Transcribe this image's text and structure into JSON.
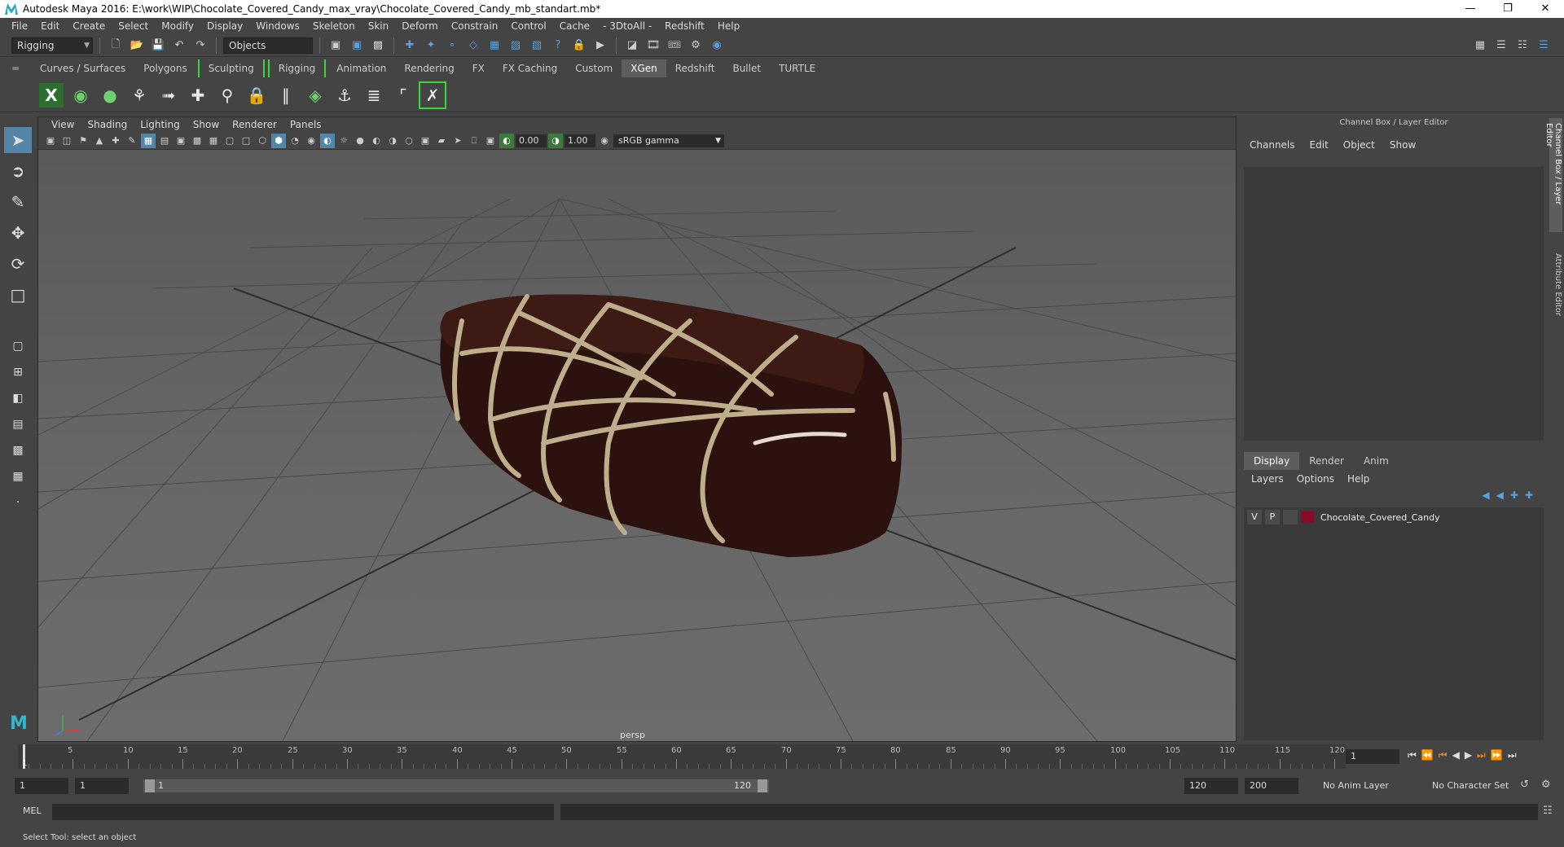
{
  "window": {
    "title": "Autodesk Maya 2016: E:\\work\\WIP\\Chocolate_Covered_Candy_max_vray\\Chocolate_Covered_Candy_mb_standart.mb*"
  },
  "menubar": [
    "File",
    "Edit",
    "Create",
    "Select",
    "Modify",
    "Display",
    "Windows",
    "Skeleton",
    "Skin",
    "Deform",
    "Constrain",
    "Control",
    "Cache",
    "- 3DtoAll -",
    "Redshift",
    "Help"
  ],
  "statusline": {
    "menuset": "Rigging",
    "selection_mode": "Objects"
  },
  "shelf_tabs": [
    "Curves / Surfaces",
    "Polygons",
    "Sculpting",
    "Rigging",
    "Animation",
    "Rendering",
    "FX",
    "FX Caching",
    "Custom",
    "XGen",
    "Redshift",
    "Bullet",
    "TURTLE"
  ],
  "active_shelf_tab": "XGen",
  "viewport": {
    "menu": [
      "View",
      "Shading",
      "Lighting",
      "Show",
      "Renderer",
      "Panels"
    ],
    "exposure": "0.00",
    "gamma": "1.00",
    "color_space": "sRGB gamma",
    "camera_label": "persp"
  },
  "channel_box": {
    "title": "Channel Box / Layer Editor",
    "menu": [
      "Channels",
      "Edit",
      "Object",
      "Show"
    ]
  },
  "layer_editor": {
    "tabs": [
      "Display",
      "Render",
      "Anim"
    ],
    "active_tab": "Display",
    "menu": [
      "Layers",
      "Options",
      "Help"
    ],
    "layers": [
      {
        "visible": "V",
        "playback": "P",
        "name": "Chocolate_Covered_Candy",
        "color": "#8b0a2a"
      }
    ]
  },
  "side_tabs": [
    "Channel Box / Layer Editor",
    "Attribute Editor"
  ],
  "timeline": {
    "ticks": [
      "5",
      "10",
      "15",
      "20",
      "25",
      "30",
      "35",
      "40",
      "45",
      "50",
      "55",
      "60",
      "65",
      "70",
      "75",
      "80",
      "85",
      "90",
      "95",
      "100",
      "105",
      "110",
      "115",
      "120"
    ],
    "current_frame": "1",
    "current_frame_field": "1"
  },
  "range": {
    "start": "1",
    "playback_start": "1",
    "bar_start": "1",
    "bar_end": "120",
    "playback_end": "120",
    "end": "200",
    "anim_layer": "No Anim Layer",
    "character_set": "No Character Set"
  },
  "command_line": {
    "label": "MEL"
  },
  "help_line": "Select Tool: select an object"
}
